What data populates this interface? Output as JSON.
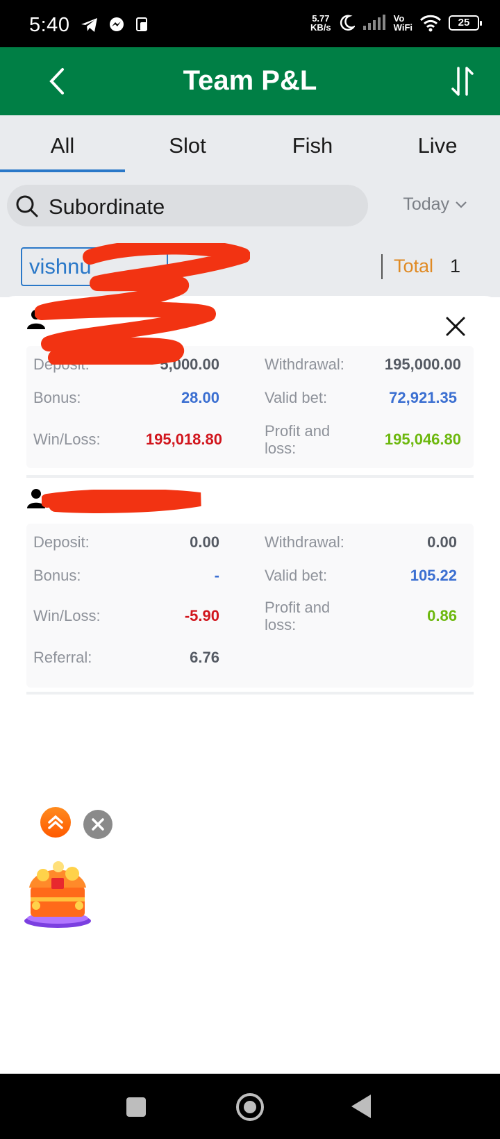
{
  "status_bar": {
    "time": "5:40",
    "net_speed_value": "5.77",
    "net_speed_unit": "KB/s",
    "vo_label": "Vo",
    "wifi_label": "WiFi",
    "battery": "25"
  },
  "header": {
    "title": "Team P&L"
  },
  "tabs": [
    {
      "label": "All",
      "active": true
    },
    {
      "label": "Slot",
      "active": false
    },
    {
      "label": "Fish",
      "active": false
    },
    {
      "label": "Live",
      "active": false
    }
  ],
  "search": {
    "label": "Subordinate",
    "period": "Today"
  },
  "filter": {
    "user_chip": "vishnu",
    "total_label": "Total",
    "total_value": "1"
  },
  "members": [
    {
      "stats": {
        "deposit_label": "Deposit:",
        "deposit": "5,000.00",
        "withdrawal_label": "Withdrawal:",
        "withdrawal": "195,000.00",
        "bonus_label": "Bonus:",
        "bonus": "28.00",
        "valid_bet_label": "Valid bet:",
        "valid_bet": "72,921.35",
        "winloss_label": "Win/Loss:",
        "winloss": "195,018.80",
        "pnl_label_1": "Profit and",
        "pnl_label_2": "loss:",
        "pnl": "195,046.80"
      }
    },
    {
      "stats": {
        "deposit_label": "Deposit:",
        "deposit": "0.00",
        "withdrawal_label": "Withdrawal:",
        "withdrawal": "0.00",
        "bonus_label": "Bonus:",
        "bonus": "-",
        "valid_bet_label": "Valid bet:",
        "valid_bet": "105.22",
        "winloss_label": "Win/Loss:",
        "winloss": "-5.90",
        "pnl_label_1": "Profit and",
        "pnl_label_2": "loss:",
        "pnl": "0.86",
        "referral_label": "Referral:",
        "referral": "6.76"
      }
    }
  ],
  "colors": {
    "header_green": "#007f45",
    "accent_blue": "#2a78c8",
    "value_blue": "#3b6fd1",
    "loss_red": "#d1161d",
    "profit_green": "#6db80e",
    "total_orange": "#e08a23"
  }
}
